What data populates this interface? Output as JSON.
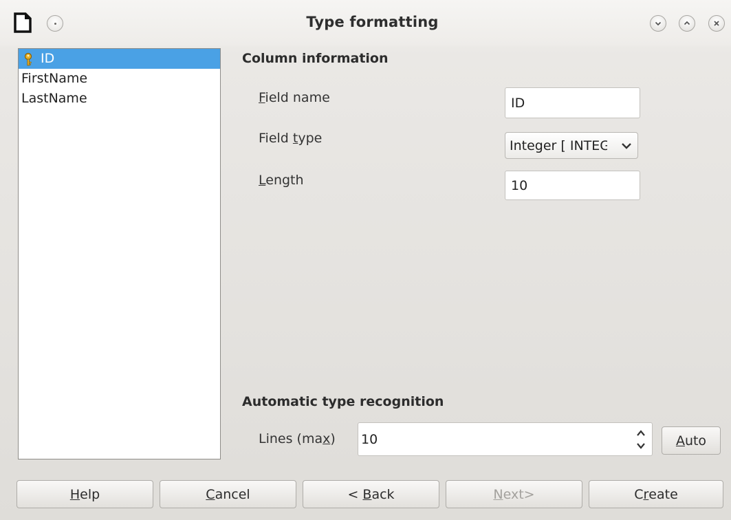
{
  "window": {
    "title": "Type formatting",
    "app_icon": "document-icon",
    "controls": [
      "minimize",
      "maximize",
      "close"
    ]
  },
  "field_list": {
    "items": [
      {
        "label": "ID",
        "primary_key": true,
        "selected": true
      },
      {
        "label": "FirstName",
        "primary_key": false,
        "selected": false
      },
      {
        "label": "LastName",
        "primary_key": false,
        "selected": false
      }
    ]
  },
  "column_info": {
    "heading": "Column information",
    "field_name_label_mnemonic": "F",
    "field_name_label_rest": "ield name",
    "field_name_value": "ID",
    "field_type_label_pre": "Field ",
    "field_type_label_mnemonic": "t",
    "field_type_label_rest": "ype",
    "field_type_value": "Integer [ INTEGER ]",
    "length_label_mnemonic": "L",
    "length_label_rest": "ength",
    "length_value": "10"
  },
  "auto_recognition": {
    "heading": "Automatic type recognition",
    "lines_label_pre": "Lines (ma",
    "lines_label_mnemonic": "x",
    "lines_label_post": ")",
    "lines_value": "10",
    "auto_button_mnemonic": "A",
    "auto_button_rest": "uto"
  },
  "buttons": {
    "help_mnemonic": "H",
    "help_rest": "elp",
    "cancel_mnemonic": "C",
    "cancel_rest": "ancel",
    "back_pre": "< ",
    "back_mnemonic": "B",
    "back_rest": "ack",
    "next_mnemonic": "N",
    "next_rest": "ext>",
    "create_pre": "C",
    "create_mnemonic": "r",
    "create_rest": "eate"
  },
  "colors": {
    "selection": "#4aa1e5",
    "key_icon": "#d9a21b"
  }
}
